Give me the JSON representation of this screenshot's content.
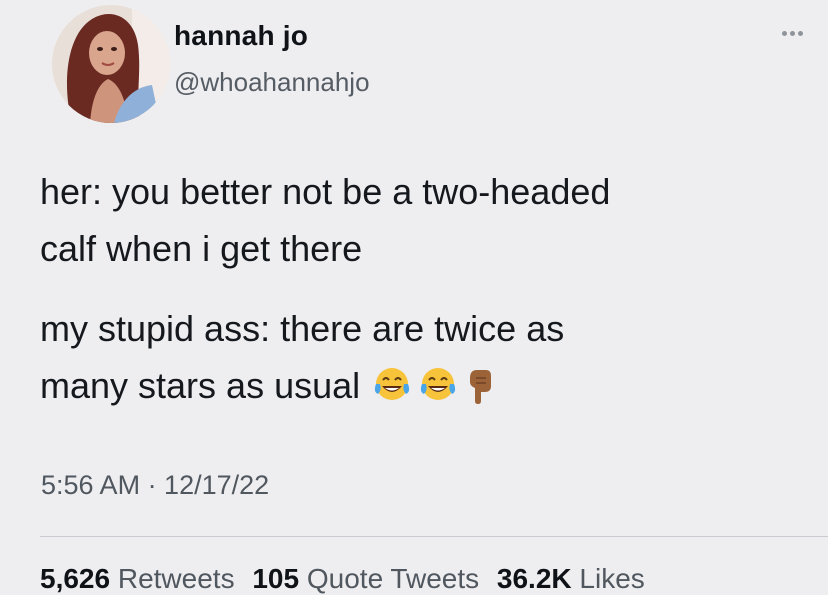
{
  "user": {
    "display_name": "hannah jo",
    "handle": "@whoahannahjo"
  },
  "tweet": {
    "line1": "her: you better not be a two-headed",
    "line2": "calf when i get there",
    "line3": "my stupid ass: there are twice as",
    "line4": "many stars as usual",
    "emojis": [
      "face-with-tears-of-joy-icon",
      "face-with-tears-of-joy-icon",
      "pointing-down-hand-icon"
    ],
    "timestamp": "5:56 AM · 12/17/22"
  },
  "stats": {
    "retweets_count": "5,626",
    "retweets_label": "Retweets",
    "quotes_count": "105",
    "quotes_label": "Quote Tweets",
    "likes_count": "36.2K",
    "likes_label": "Likes"
  },
  "colors": {
    "background": "#eeeef1",
    "primary_text": "#15181c",
    "secondary_text": "#555c63"
  }
}
